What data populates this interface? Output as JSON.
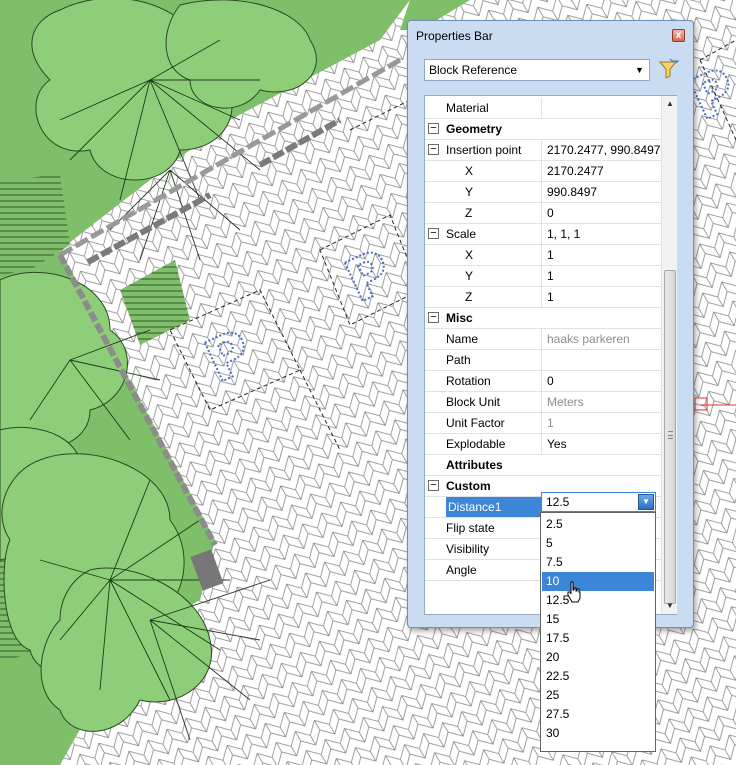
{
  "panel": {
    "title": "Properties Bar",
    "close_glyph": "x",
    "object_type": "Block Reference",
    "filter_icon": "quick-select-funnel-icon"
  },
  "map_labels": {
    "parking_symbol": "P"
  },
  "properties": [
    {
      "label": "Material",
      "value": ""
    },
    {
      "label": "Geometry",
      "value": ""
    },
    {
      "label": "Insertion point",
      "value": "2170.2477, 990.8497"
    },
    {
      "label": "X",
      "value": "2170.2477"
    },
    {
      "label": "Y",
      "value": "990.8497"
    },
    {
      "label": "Z",
      "value": "0"
    },
    {
      "label": "Scale",
      "value": "1, 1, 1"
    },
    {
      "label": "X",
      "value": "1"
    },
    {
      "label": "Y",
      "value": "1"
    },
    {
      "label": "Z",
      "value": "1"
    },
    {
      "label": "Misc",
      "value": ""
    },
    {
      "label": "Name",
      "value": "haaks parkeren"
    },
    {
      "label": "Path",
      "value": ""
    },
    {
      "label": "Rotation",
      "value": "0"
    },
    {
      "label": "Block Unit",
      "value": "Meters"
    },
    {
      "label": "Unit Factor",
      "value": "1"
    },
    {
      "label": "Explodable",
      "value": "Yes"
    },
    {
      "label": "Attributes",
      "value": ""
    },
    {
      "label": "Custom",
      "value": ""
    },
    {
      "label": "Distance1",
      "value": "12.5"
    },
    {
      "label": "Flip state",
      "value": ""
    },
    {
      "label": "Visibility",
      "value": ""
    },
    {
      "label": "Angle",
      "value": ""
    }
  ],
  "toggles": {
    "collapse": "−"
  },
  "dropdown": {
    "options": [
      "2.5",
      "5",
      "7.5",
      "10",
      "12.5",
      "15",
      "17.5",
      "20",
      "22.5",
      "25",
      "27.5",
      "30"
    ],
    "highlighted": "10"
  },
  "colors": {
    "accent": "#3d85d6",
    "grass": "#7fbf6a",
    "paving": "#ffffff",
    "panel_bg": "#c9dcf1"
  }
}
